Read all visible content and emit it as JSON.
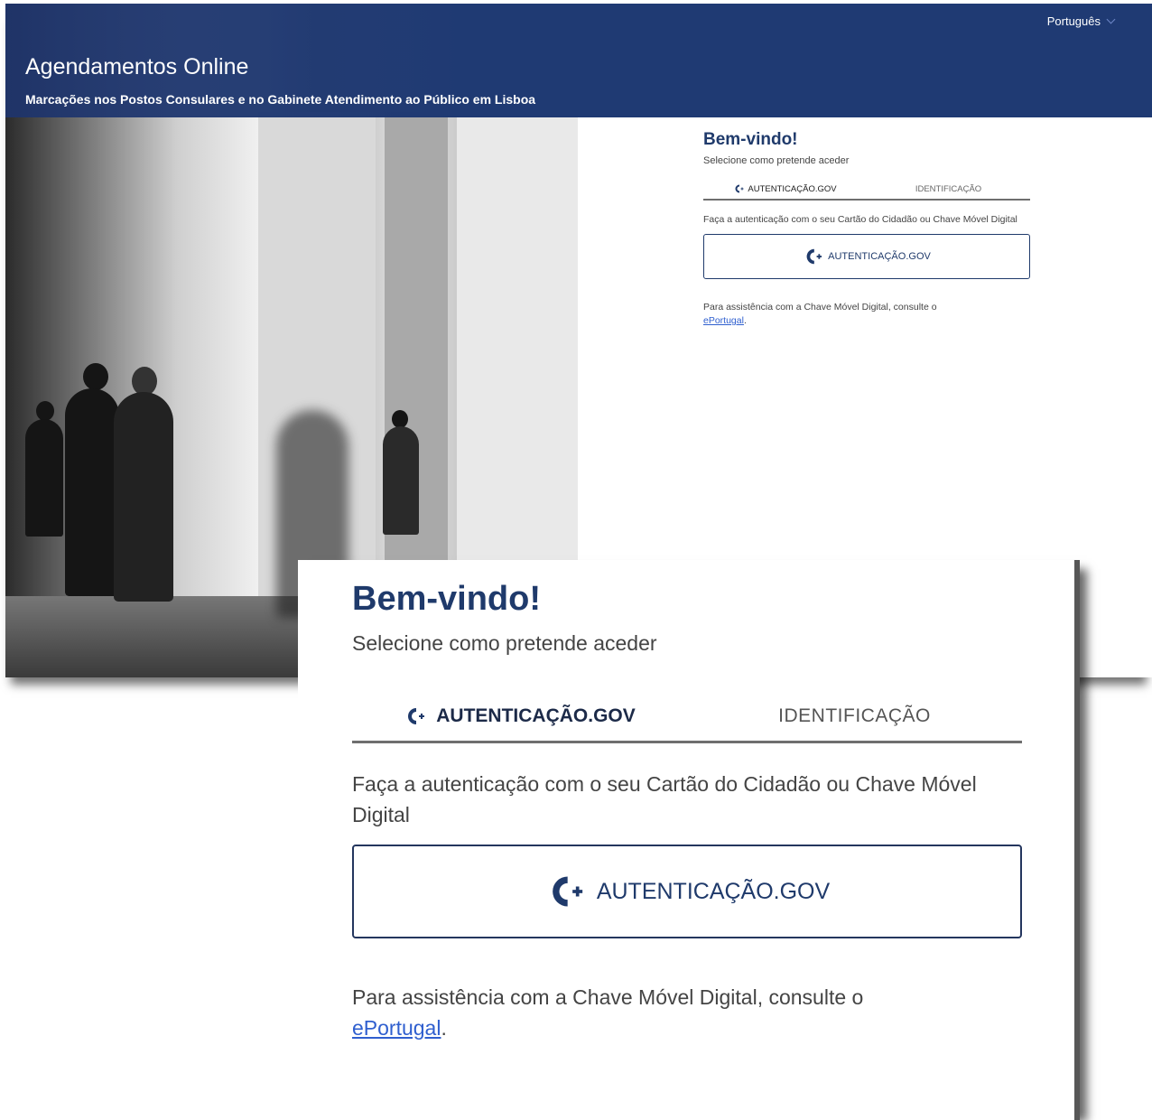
{
  "header": {
    "language": "Português",
    "title": "Agendamentos Online",
    "subtitle": "Marcações nos Postos Consulares e no Gabinete Atendimento ao Público em Lisboa"
  },
  "login": {
    "welcome": "Bem-vindo!",
    "select_prompt": "Selecione como pretende aceder",
    "tabs": [
      {
        "label": "AUTENTICAÇÃO.GOV",
        "active": true
      },
      {
        "label": "IDENTIFICAÇÃO",
        "active": false
      }
    ],
    "description": "Faça a autenticação com o seu Cartão do Cidadão ou Chave Móvel Digital",
    "auth_button": "AUTENTICAÇÃO.GOV",
    "help_text": "Para assistência com a Chave Móvel Digital, consulte o",
    "help_link": "ePortugal",
    "help_end": "."
  },
  "colors": {
    "header_bg": "#1f3a73",
    "brand_text": "#1f3a6b",
    "link": "#2f5fcf"
  },
  "icons": {
    "gov": "autenticacao-gov-icon",
    "language": "chevron-down-icon"
  }
}
